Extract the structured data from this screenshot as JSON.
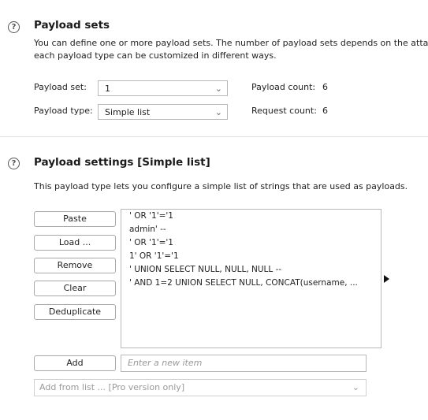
{
  "payload_sets": {
    "help_icon": "?",
    "title": "Payload sets",
    "description_line1": "You can define one or more payload sets. The number of payload sets depends on the atta",
    "description_line2": "each payload type can be customized in different ways.",
    "set_label": "Payload set:",
    "set_value": "1",
    "type_label": "Payload type:",
    "type_value": "Simple list",
    "count_label": "Payload count:",
    "count_value": "6",
    "request_label": "Request count:",
    "request_value": "6"
  },
  "payload_settings": {
    "help_icon": "?",
    "title": "Payload settings [Simple list]",
    "description": "This payload type lets you configure a simple list of strings that are used as payloads.",
    "buttons": {
      "paste": "Paste",
      "load": "Load ...",
      "remove": "Remove",
      "clear": "Clear",
      "deduplicate": "Deduplicate",
      "add": "Add"
    },
    "items": [
      "' OR '1'='1",
      "admin' --",
      "' OR '1'='1",
      "1' OR '1'='1",
      "' UNION SELECT NULL, NULL, NULL --",
      "' AND 1=2 UNION SELECT NULL, CONCAT(username, ..."
    ],
    "new_item_placeholder": "Enter a new item",
    "add_from_list": "Add from list ... [Pro version only]"
  },
  "icons": {
    "dropdown": "chevron-down-icon",
    "expand": "triangle-right-icon",
    "help": "help-circle-icon"
  }
}
